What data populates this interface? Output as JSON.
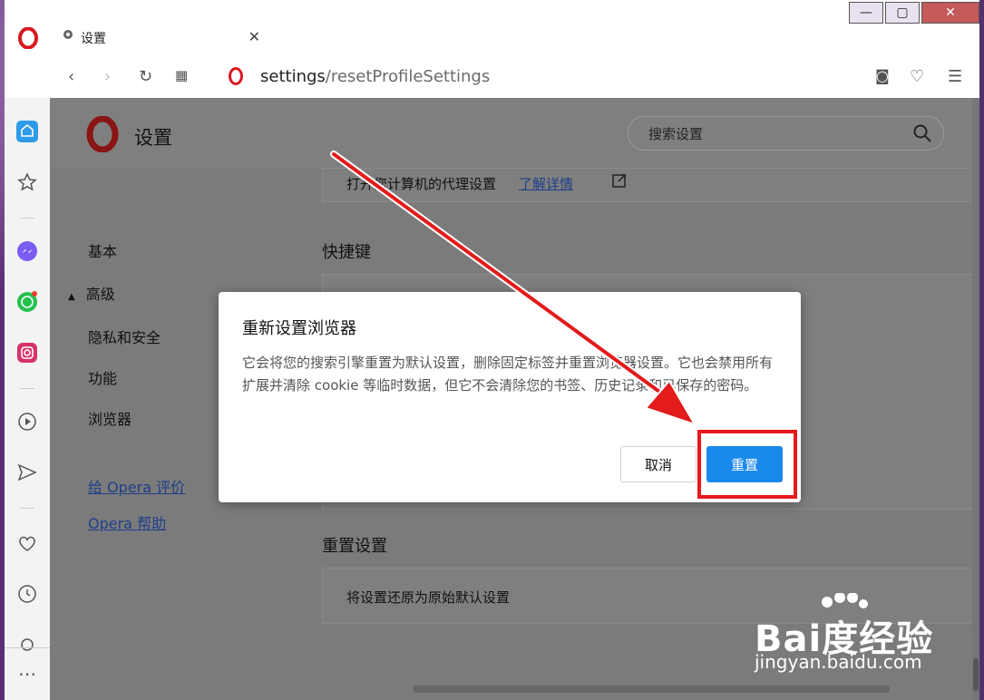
{
  "tab": {
    "title": "设置"
  },
  "url": {
    "host": "settings",
    "path": "/resetProfileSettings"
  },
  "page": {
    "title": "设置",
    "search_placeholder": "搜索设置"
  },
  "left_nav": {
    "basic": "基本",
    "advanced": "高级",
    "privacy": "隐私和安全",
    "features": "功能",
    "browser": "浏览器",
    "rate": "给 Opera 评价",
    "help": "Opera 帮助"
  },
  "content": {
    "proxy_text": "打开您计算机的代理设置",
    "proxy_link": "了解详情",
    "shortcuts_title": "快捷键",
    "reset_title": "重置设置",
    "reset_item": "将设置还原为原始默认设置"
  },
  "dialog": {
    "title": "重新设置浏览器",
    "body": "它会将您的搜索引擎重置为默认设置，删除固定标签并重置浏览器设置。它也会禁用所有扩展并清除 cookie 等临时数据，但它不会清除您的书签、历史记录和已保存的密码。",
    "cancel": "取消",
    "reset": "重置"
  },
  "watermark": {
    "brand": "Bai度经验",
    "sub": "jingyan.baidu.com"
  },
  "colors": {
    "accent": "#1a89ec",
    "highlight": "#e6191e",
    "opera_red": "#d71920"
  }
}
